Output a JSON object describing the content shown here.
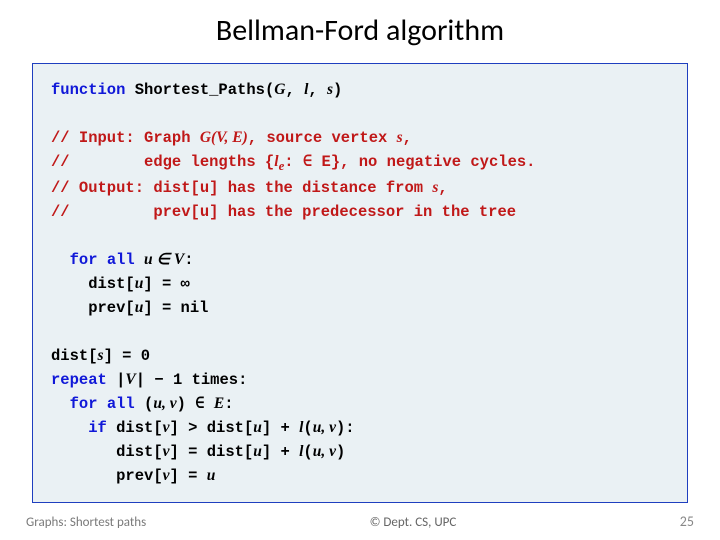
{
  "title": "Bellman-Ford algorithm",
  "code": {
    "l1a": "function",
    "l1b": " Shortest_Paths(",
    "l1c": "G",
    "l1d": ", ",
    "l1e": "l",
    "l1f": ", ",
    "l1g": "s",
    "l1h": ")",
    "c1": "// Input: Graph ",
    "c1b": "G(V, E)",
    "c1c": ", source vertex ",
    "c1d": "s",
    "c1e": ",",
    "c2": "//        edge lengths {",
    "c2b": "l",
    "c2b2": "e",
    "c2c": ": ∈ E}, no negative cycles.",
    "c3": "// Output: dist[u] has the distance from ",
    "c3b": "s",
    "c3c": ",",
    "c4": "//         prev[u] has the predecessor in the tree",
    "f1a": "for all",
    "f1b": " ",
    "f1c": "u ∈ V",
    "f1d": ":",
    "f2": "    dist[",
    "f2b": "u",
    "f2c": "] = ∞",
    "f3": "    prev[",
    "f3b": "u",
    "f3c": "] = nil",
    "g1": "dist[",
    "g1b": "s",
    "g1c": "] = 0",
    "g2a": "repeat",
    "g2b": " |",
    "g2c": "V",
    "g2d": "| − 1 times:",
    "g3a": "for all",
    "g3b": " (",
    "g3c": "u, v",
    "g3d": ") ∈ ",
    "g3e": "E",
    "g3f": ":",
    "g4a": "if",
    "g4b": " dist[",
    "g4c": "v",
    "g4d": "] > dist[",
    "g4e": "u",
    "g4f": "] + ",
    "g4g": "l",
    "g4h": "(",
    "g4i": "u, v",
    "g4j": "):",
    "g5": "       dist[",
    "g5b": "v",
    "g5c": "] = dist[",
    "g5d": "u",
    "g5e": "] + ",
    "g5f": "l",
    "g5g": "(",
    "g5h": "u, v",
    "g5i": ")",
    "g6": "       prev[",
    "g6b": "v",
    "g6c": "] = ",
    "g6d": "u"
  },
  "footer": {
    "left": "Graphs: Shortest paths",
    "center": "© Dept. CS, UPC",
    "right": "25"
  }
}
